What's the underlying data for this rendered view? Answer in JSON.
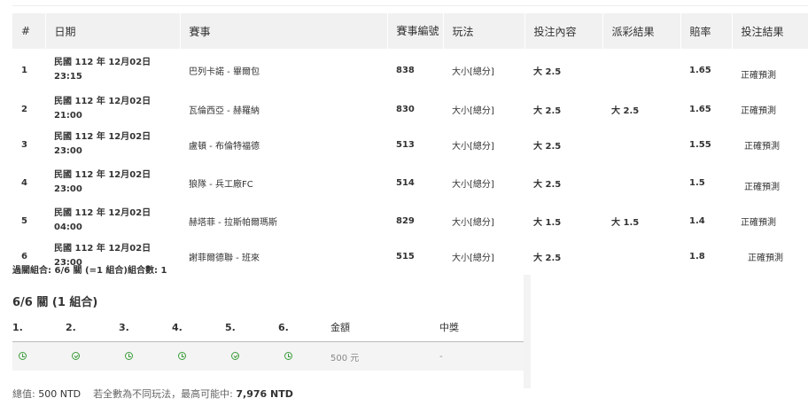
{
  "bets_table": {
    "headers": [
      "#",
      "日期",
      "賽事",
      "賽事編號",
      "玩法",
      "投注內容",
      "派彩結果",
      "賠率",
      "投注結果"
    ],
    "rows": [
      {
        "idx": "1",
        "date1": "民國 112 年 12月02日",
        "date2": "23:15",
        "match": "巴列卡諾 - 畢爾包",
        "code": "838",
        "play": "大小[總分]",
        "bet": "大 2.5",
        "payout": "",
        "odds": "1.65",
        "result": "正確預測"
      },
      {
        "idx": "2",
        "date1": "民國 112 年 12月02日",
        "date2": "21:00",
        "match": "瓦倫西亞 - 赫羅納",
        "code": "830",
        "play": "大小[總分]",
        "bet": "大 2.5",
        "payout": "大 2.5",
        "odds": "1.65",
        "result": "正確預測"
      },
      {
        "idx": "3",
        "date1": "民國 112 年 12月02日",
        "date2": "23:00",
        "match": "盧頓 - 布倫特福德",
        "code": "513",
        "play": "大小[總分]",
        "bet": "大 2.5",
        "payout": "",
        "odds": "1.55",
        "result": "正確預測"
      },
      {
        "idx": "4",
        "date1": "民國 112 年 12月02日",
        "date2": "23:00",
        "match": "狼隊 - 兵工廠FC",
        "code": "514",
        "play": "大小[總分]",
        "bet": "大 2.5",
        "payout": "",
        "odds": "1.5",
        "result": "正確預測"
      },
      {
        "idx": "5",
        "date1": "民國 112 年 12月02日",
        "date2": "04:00",
        "match": "赫塔菲 - 拉斯帕爾瑪斯",
        "code": "829",
        "play": "大小[總分]",
        "bet": "大 1.5",
        "payout": "大 1.5",
        "odds": "1.4",
        "result": "正確預測"
      },
      {
        "idx": "6",
        "date1": "民國 112 年 12月02日",
        "date2": "23:00",
        "match": "謝菲爾德聯 - 班來",
        "code": "515",
        "play": "大小[總分]",
        "bet": "大 2.5",
        "payout": "",
        "odds": "1.8",
        "result": "正確預測"
      }
    ]
  },
  "summary": "過關組合: 6/6 關 (=1 組合)組合數: 1",
  "combo": {
    "title": "6/6 關 (1 組合)",
    "headers": [
      "1.",
      "2.",
      "3.",
      "4.",
      "5.",
      "6.",
      "金額",
      "中獎"
    ],
    "icons": [
      "clock-icon",
      "check-icon",
      "clock-icon",
      "clock-icon",
      "check-icon",
      "clock-icon"
    ],
    "amount": "500 元",
    "prize": "-"
  },
  "footer": {
    "total_label": "總值:",
    "total_value": "500 NTD",
    "note": "若全數為不同玩法，最高可能中:",
    "max_win": "7,976 NTD"
  },
  "colors": {
    "header_bg": "#f1f1f1",
    "icon_green": "#3a9c3a"
  }
}
